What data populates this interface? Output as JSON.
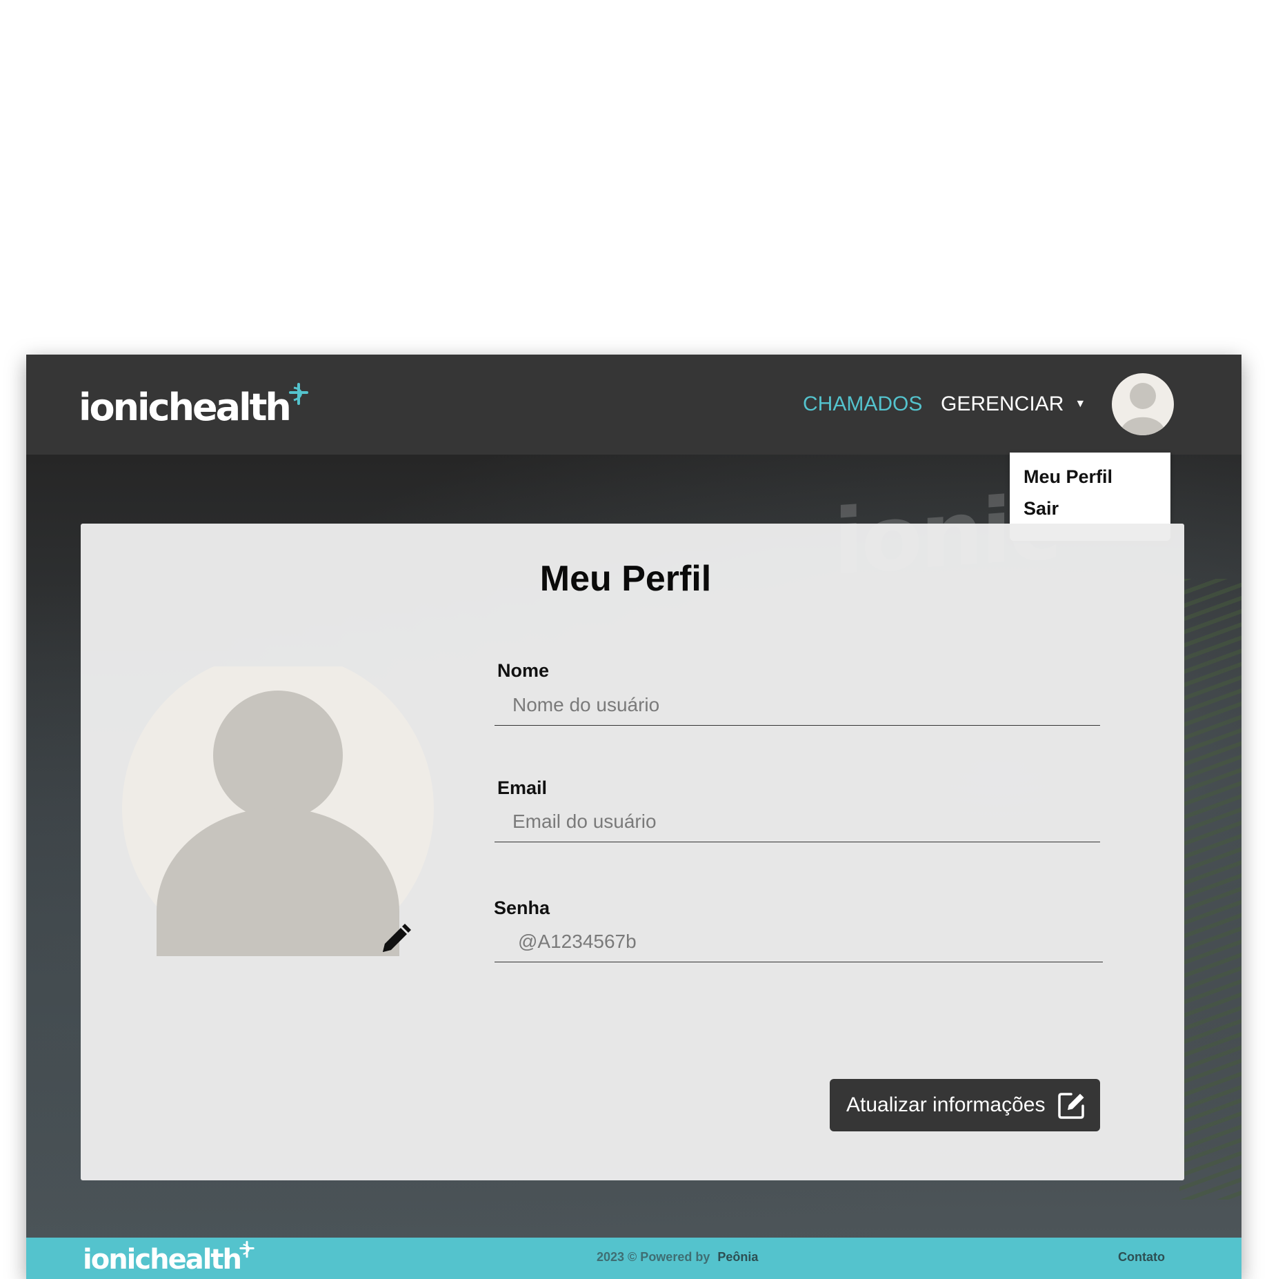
{
  "brand": {
    "logo_text": "ionichealth"
  },
  "nav": {
    "chamados": "CHAMADOS",
    "gerenciar": "GERENCIAR",
    "gerenciar_caret": "▼",
    "accent_color": "#54c3cd"
  },
  "user_menu": {
    "items": [
      "Meu Perfil",
      "Sair"
    ]
  },
  "profile": {
    "title": "Meu Perfil",
    "fields": {
      "nome": {
        "label": "Nome",
        "placeholder": "Nome do usuário"
      },
      "email": {
        "label": "Email",
        "placeholder": "Email do usuário"
      },
      "senha": {
        "label": "Senha",
        "placeholder": "@A1234567b"
      }
    },
    "update_button": "Atualizar informações",
    "icons": {
      "avatar": "user-silhouette-icon",
      "edit_photo": "pencil-icon",
      "update": "edit-square-icon"
    }
  },
  "footer": {
    "logo_text": "ionichealth",
    "copyright": "2023 © Powered by",
    "powered_brand": "Peônia",
    "contato": "Contato",
    "background_color": "#54c3cd"
  }
}
